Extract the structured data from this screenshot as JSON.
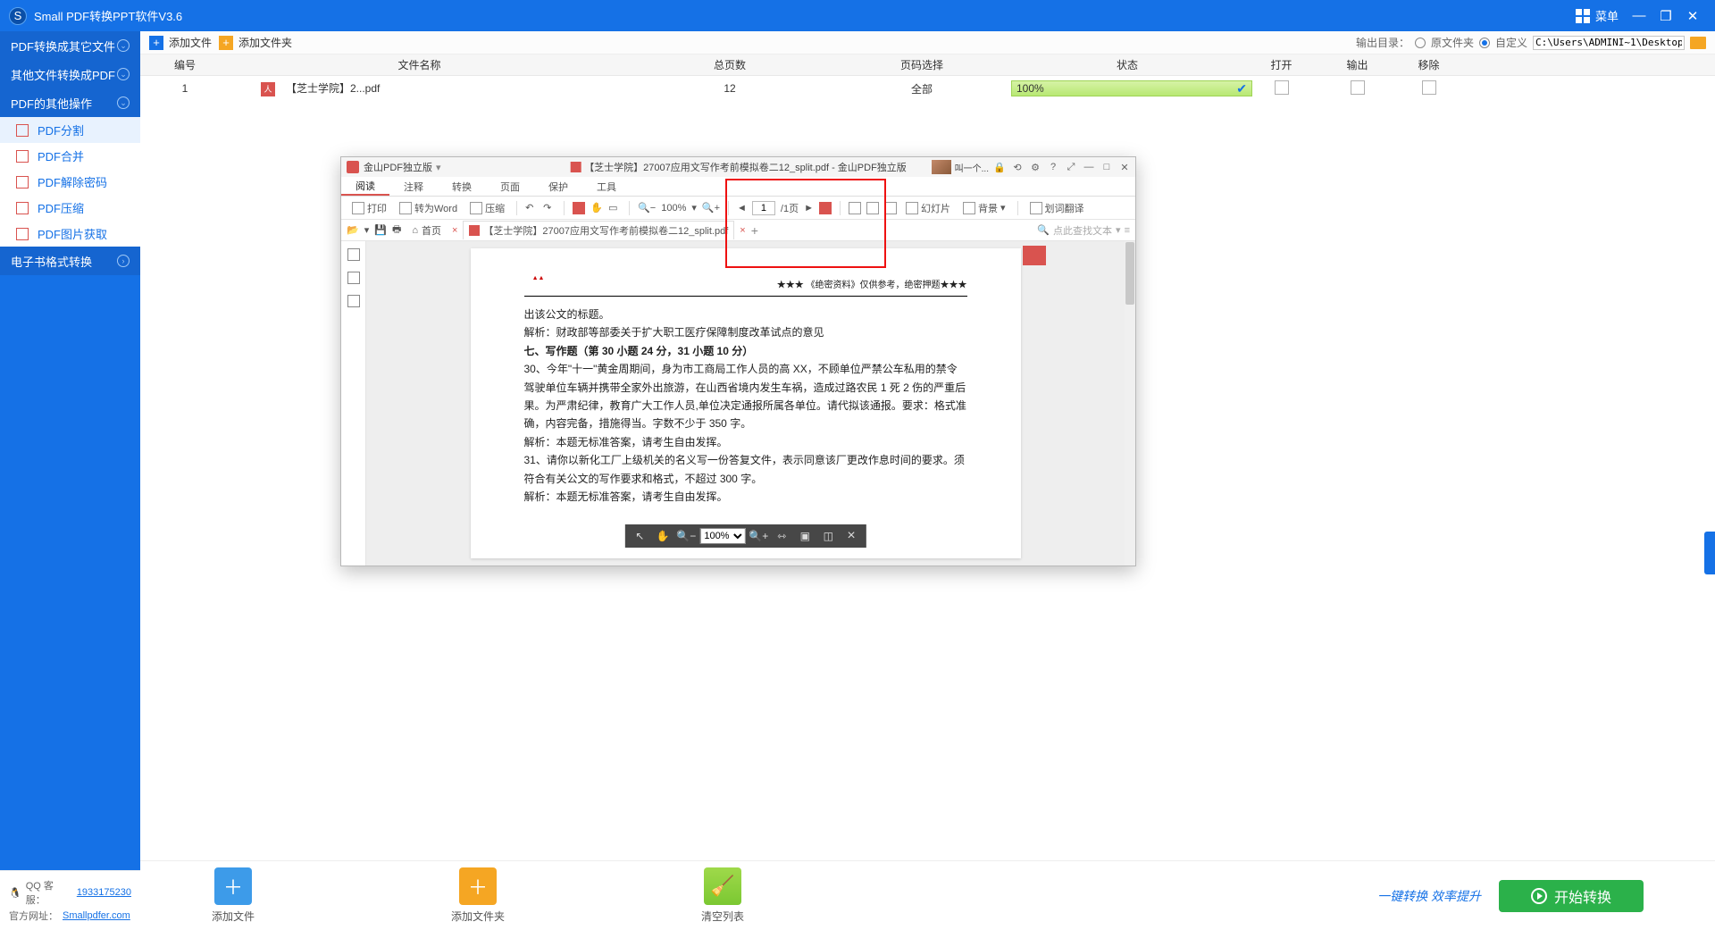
{
  "app": {
    "title": "Small PDF转换PPT软件V3.6",
    "menu": "菜单"
  },
  "sidebar": {
    "groups": [
      {
        "label": "PDF转换成其它文件"
      },
      {
        "label": "其他文件转换成PDF"
      },
      {
        "label": "PDF的其他操作"
      },
      {
        "label": "电子书格式转换"
      }
    ],
    "items": [
      "PDF分割",
      "PDF合并",
      "PDF解除密码",
      "PDF压缩",
      "PDF图片获取"
    ]
  },
  "toolbar": {
    "addFile": "添加文件",
    "addFolder": "添加文件夹",
    "outLabel": "输出目录：",
    "radioSrc": "原文件夹",
    "radioCustom": "自定义",
    "path": "C:\\Users\\ADMINI~1\\Desktop"
  },
  "table": {
    "headers": {
      "idx": "编号",
      "name": "文件名称",
      "pages": "总页数",
      "pagesel": "页码选择",
      "status": "状态",
      "open": "打开",
      "out": "输出",
      "del": "移除"
    },
    "rows": [
      {
        "idx": "1",
        "name": "【芝士学院】2...pdf",
        "pages": "12",
        "pagesel": "全部",
        "statusPct": "100%"
      }
    ]
  },
  "viewer": {
    "brand": "金山PDF独立版",
    "titleTab": "【芝士学院】27007应用文写作考前模拟卷二12_split.pdf - 金山PDF独立版",
    "extraText": "叫一个...",
    "menus": [
      "阅读",
      "注释",
      "转换",
      "页面",
      "保护",
      "工具"
    ],
    "tools": {
      "print": "打印",
      "toWord": "转为Word",
      "compress": "压缩",
      "zoom": "100%",
      "page": "1",
      "pageTotal": "/1页",
      "slides": "幻灯片",
      "bg": "背景",
      "translate": "划词翻译"
    },
    "homeTab": "首页",
    "fileTab": "【芝士学院】27007应用文写作考前模拟卷二12_split.pdf",
    "searchHint": "点此查找文本",
    "floatZoom": "100%",
    "doc": {
      "hdrRight": "★★★ 《绝密资料》仅供参考，绝密押题★★★",
      "lines": [
        "出该公文的标题。",
        "解析：财政部等部委关于扩大职工医疗保障制度改革试点的意见",
        "七、写作题（第 30 小题 24 分，31 小题 10 分）",
        "30、今年\"十一\"黄金周期间，身为市工商局工作人员的高 XX，不顾单位严禁公车私用的禁令驾驶单位车辆并携带全家外出旅游，在山西省境内发生车祸，造成过路农民 1 死 2 伤的严重后果。为严肃纪律，教育广大工作人员,单位决定通报所属各单位。请代拟该通报。要求：格式准确，内容完备，措施得当。字数不少于 350 字。",
        "解析：本题无标准答案，请考生自由发挥。",
        "31、请你以新化工厂上级机关的名义写一份答复文件，表示同意该厂更改作息时间的要求。须符合有关公文的写作要求和格式，不超过 300 字。",
        "解析：本题无标准答案，请考生自由发挥。"
      ]
    }
  },
  "footer": {
    "qqLabel": "QQ 客服：",
    "qq": "1933175230",
    "siteLabel": "官方网址：",
    "site": "Smallpdfer.com",
    "addFile": "添加文件",
    "addFolder": "添加文件夹",
    "clear": "清空列表",
    "slogan": "一键转换 效率提升",
    "start": "开始转换"
  }
}
